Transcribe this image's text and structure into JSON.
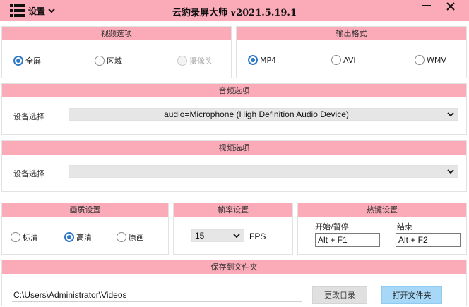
{
  "window": {
    "title": "云豹录屏大师  v2021.5.19.1",
    "menu_label": "设置",
    "accent_pink": "#fbaab8",
    "accent_blue": "#2f79c8",
    "icons": [
      "hamburger-icon",
      "chevron-down-icon",
      "minimize-icon",
      "close-icon"
    ]
  },
  "video_options": {
    "header": "视频选项",
    "options": [
      {
        "label": "全屏",
        "checked": true,
        "disabled": false
      },
      {
        "label": "区域",
        "checked": false,
        "disabled": false
      },
      {
        "label": "摄像头",
        "checked": false,
        "disabled": true
      }
    ]
  },
  "output_format": {
    "header": "输出格式",
    "options": [
      {
        "label": "MP4",
        "checked": true
      },
      {
        "label": "AVI",
        "checked": false
      },
      {
        "label": "WMV",
        "checked": false
      }
    ]
  },
  "audio_options": {
    "header": "音频选项",
    "device_label": "设备选择",
    "device_value": "audio=Microphone (High Definition Audio Device)"
  },
  "video_device": {
    "header": "视频选项",
    "device_label": "设备选择",
    "device_value": ""
  },
  "quality": {
    "header": "画质设置",
    "options": [
      {
        "label": "标清",
        "checked": false
      },
      {
        "label": "高清",
        "checked": true
      },
      {
        "label": "原画",
        "checked": false
      }
    ]
  },
  "framerate": {
    "header": "帧率设置",
    "value": "15",
    "unit": "FPS"
  },
  "hotkeys": {
    "header": "热键设置",
    "start_label": "开始/暂停",
    "start_value": "Alt + F1",
    "end_label": "结束",
    "end_value": "Alt + F2"
  },
  "save": {
    "header": "保存到文件夹",
    "path": "C:\\Users\\Administrator\\Videos",
    "change_dir_label": "更改目录",
    "open_folder_label": "打开文件夹"
  }
}
